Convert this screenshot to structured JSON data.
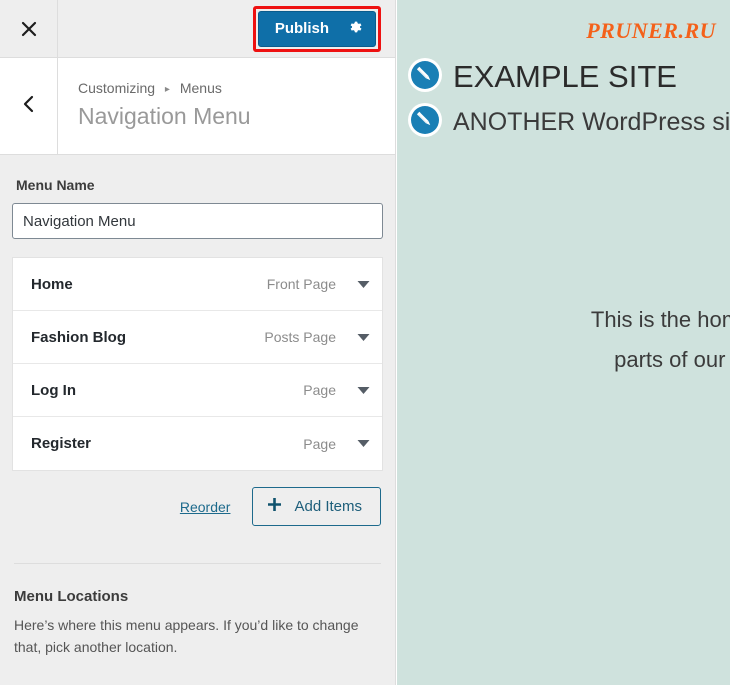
{
  "topbar": {
    "close_icon": "close-icon",
    "publish_label": "Publish",
    "publish_gear_icon": "gear-icon",
    "highlight_color": "#ee1111",
    "publish_bg": "#0f6fa8"
  },
  "titlebar": {
    "back_icon": "chevron-left-icon",
    "breadcrumb_root": "Customizing",
    "breadcrumb_separator": "▸",
    "breadcrumb_current": "Menus",
    "panel_title": "Navigation Menu"
  },
  "menu_name": {
    "label": "Menu Name",
    "value": "Navigation Menu",
    "placeholder": "Menu Name"
  },
  "menu_items": [
    {
      "name": "Home",
      "type": "Front Page",
      "caret_icon": "caret-down-icon"
    },
    {
      "name": "Fashion Blog",
      "type": "Posts Page",
      "caret_icon": "caret-down-icon"
    },
    {
      "name": "Log In",
      "type": "Page",
      "caret_icon": "caret-down-icon"
    },
    {
      "name": "Register",
      "type": "Page",
      "caret_icon": "caret-down-icon"
    }
  ],
  "actions": {
    "reorder_label": "Reorder",
    "add_items_label": "Add Items",
    "add_items_icon": "plus-icon"
  },
  "menu_locations": {
    "title": "Menu Locations",
    "description": "Here’s where this menu appears. If you’d like to change that, pick another location."
  },
  "preview": {
    "background_color": "#cfe2dd",
    "watermark": "PRUNER.RU",
    "watermark_color": "#f4611a",
    "site_title": "EXAMPLE SITE",
    "site_tagline": "ANOTHER WordPress site",
    "edit_icon": "edit-pencil-icon",
    "edit_icon_color": "#1a7fb5",
    "body_line_1": "This is the home of o",
    "body_line_2": "parts of our web"
  }
}
